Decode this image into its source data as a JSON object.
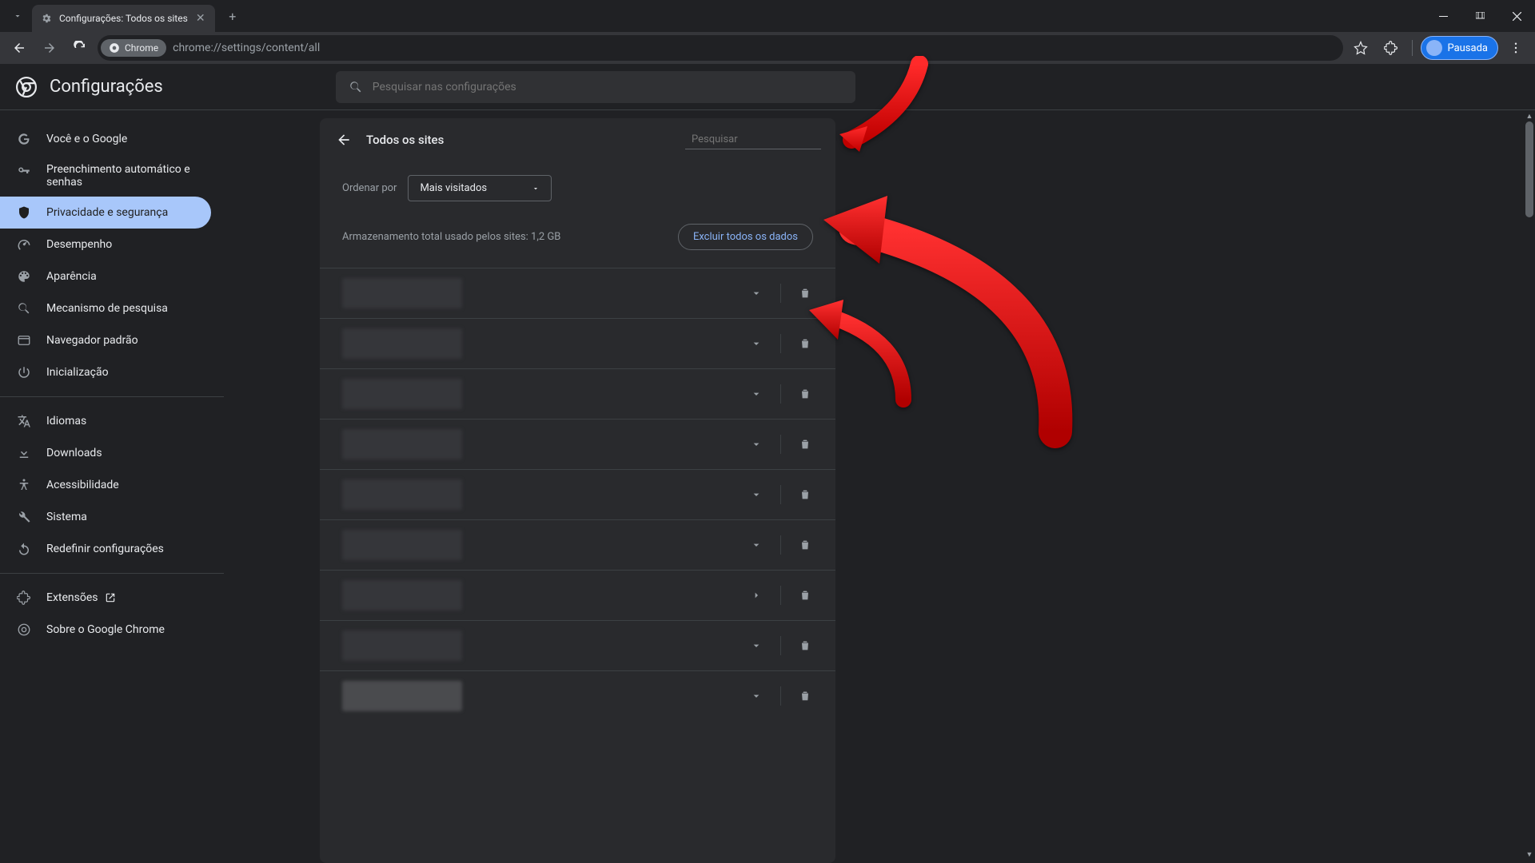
{
  "titlebar": {
    "tab_title": "Configurações: Todos os sites"
  },
  "toolbar": {
    "chrome_chip": "Chrome",
    "url": "chrome://settings/content/all",
    "profile_label": "Pausada"
  },
  "settings": {
    "title": "Configurações",
    "search_placeholder": "Pesquisar nas configurações"
  },
  "sidebar": {
    "items": [
      {
        "label": "Você e o Google"
      },
      {
        "label": "Preenchimento automático e senhas"
      },
      {
        "label": "Privacidade e segurança"
      },
      {
        "label": "Desempenho"
      },
      {
        "label": "Aparência"
      },
      {
        "label": "Mecanismo de pesquisa"
      },
      {
        "label": "Navegador padrão"
      },
      {
        "label": "Inicialização"
      }
    ],
    "secondary": [
      {
        "label": "Idiomas"
      },
      {
        "label": "Downloads"
      },
      {
        "label": "Acessibilidade"
      },
      {
        "label": "Sistema"
      },
      {
        "label": "Redefinir configurações"
      }
    ],
    "tertiary": [
      {
        "label": "Extensões"
      },
      {
        "label": "Sobre o Google Chrome"
      }
    ]
  },
  "content": {
    "page_title": "Todos os sites",
    "search_placeholder": "Pesquisar",
    "sort_label": "Ordenar por",
    "sort_value": "Mais visitados",
    "storage_text": "Armazenamento total usado pelos sites: 1,2 GB",
    "delete_all_label": "Excluir todos os dados"
  }
}
